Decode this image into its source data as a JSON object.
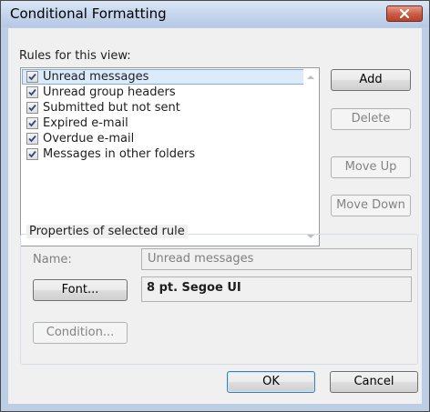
{
  "window": {
    "title": "Conditional Formatting"
  },
  "rules": {
    "label": "Rules for this view:",
    "items": [
      {
        "label": "Unread messages",
        "checked": true,
        "selected": true
      },
      {
        "label": "Unread group headers",
        "checked": true,
        "selected": false
      },
      {
        "label": "Submitted but not sent",
        "checked": true,
        "selected": false
      },
      {
        "label": "Expired e-mail",
        "checked": true,
        "selected": false
      },
      {
        "label": "Overdue e-mail",
        "checked": true,
        "selected": false
      },
      {
        "label": "Messages in other folders",
        "checked": true,
        "selected": false
      }
    ]
  },
  "side_buttons": {
    "add": "Add",
    "delete": "Delete",
    "move_up": "Move Up",
    "move_down": "Move Down"
  },
  "properties": {
    "group_label": "Properties of selected rule",
    "name_label": "Name:",
    "name_value": "Unread messages",
    "font_button": "Font...",
    "font_value": "8 pt. Segoe UI",
    "condition_button": "Condition..."
  },
  "footer": {
    "ok": "OK",
    "cancel": "Cancel"
  },
  "colors": {
    "title_bar": "#c4d4ec",
    "close_button": "#c95b43",
    "selection": "#dcebfc",
    "dialog_face": "#f0f0f0"
  }
}
